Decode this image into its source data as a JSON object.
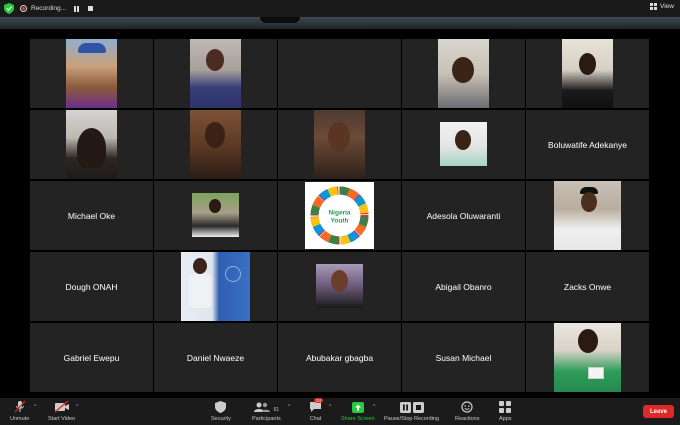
{
  "top_bar": {
    "recording_label": "Recording...",
    "view_label": "View"
  },
  "gallery": {
    "tiles": [
      {
        "name": "",
        "video": true
      },
      {
        "name": "",
        "video": true
      },
      {
        "name": "",
        "video": false
      },
      {
        "name": "",
        "video": true
      },
      {
        "name": "",
        "video": true
      },
      {
        "name": "",
        "video": true
      },
      {
        "name": "",
        "video": true
      },
      {
        "name": "",
        "video": true
      },
      {
        "name": "",
        "video": true
      },
      {
        "name": "Boluwatife Adekanye",
        "video": false
      },
      {
        "name": "Michael Oke",
        "video": false
      },
      {
        "name": "",
        "video": true
      },
      {
        "name": "",
        "video": true
      },
      {
        "name": "Adesola Oluwaranti",
        "video": false
      },
      {
        "name": "",
        "video": true
      },
      {
        "name": "Dough ONAH",
        "video": false
      },
      {
        "name": "",
        "video": true
      },
      {
        "name": "",
        "video": true
      },
      {
        "name": "Abigail Obanro",
        "video": false
      },
      {
        "name": "Zacks Onwe",
        "video": false
      },
      {
        "name": "Gabriel Ewepu",
        "video": false
      },
      {
        "name": "Daniel Nwaeze",
        "video": false
      },
      {
        "name": "Abubakar gbagba",
        "video": false
      },
      {
        "name": "Susan Michael",
        "video": false
      },
      {
        "name": "",
        "video": true
      }
    ],
    "logo_text": [
      "Nigeria",
      "Youth"
    ]
  },
  "toolbar": {
    "unmute_label": "Unmute",
    "start_video_label": "Start Video",
    "security_label": "Security",
    "participants_label": "Participants",
    "participants_count": "61",
    "chat_label": "Chat",
    "chat_badge": "24",
    "share_screen_label": "Share Screen",
    "pause_stop_label": "Pause/Stop Recording",
    "reactions_label": "Reactions",
    "apps_label": "Apps",
    "leave_label": "Leave"
  },
  "colors": {
    "share_green": "#27c93f",
    "leave_red": "#e02828",
    "tile_bg": "#232323"
  }
}
